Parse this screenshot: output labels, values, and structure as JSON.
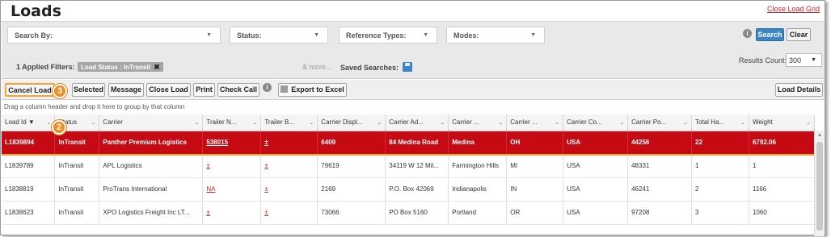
{
  "header": {
    "title": "Loads",
    "close_link": "Close Load Grid"
  },
  "filters": {
    "search_by": "Search By:",
    "status": "Status:",
    "reference_types": "Reference Types:",
    "modes": "Modes:",
    "search_btn": "Search",
    "clear_btn": "Clear",
    "applied_label": "1 Applied Filters:",
    "chip_text": "Load Status : InTransit",
    "chip_close": "✖",
    "more": "& more...",
    "saved_searches": "Saved Searches:",
    "results_count_label": "Results Count:",
    "results_count_value": "300"
  },
  "toolbar": {
    "cancel_load": "Cancel Load",
    "selected": "Selected",
    "message": "Message",
    "close_load": "Close Load",
    "print": "Print",
    "check_call": "Check Call",
    "export_excel": "Export to Excel",
    "load_details": "Load Details",
    "badge_3": "3",
    "badge_2": "2",
    "info": "i"
  },
  "grid": {
    "group_hint": "Drag a column header and drop it here to group by that column",
    "columns": [
      "Load Id ▼",
      "Status",
      "Carrier",
      "Trailer N...",
      "Trailer B...",
      "Carrier Displ...",
      "Carrier Ad...",
      "Carrier ...",
      "Carrier ...",
      "Carrier Co...",
      "Carrier Po...",
      "Total Ha...",
      "Weight"
    ],
    "rows": [
      [
        "L1839894",
        "InTransit",
        "Panther Premium Logistics",
        "538015",
        "±",
        "6409",
        "84 Medina Road",
        "Medina",
        "OH",
        "USA",
        "44256",
        "22",
        "6792.06"
      ],
      [
        "L1839789",
        "InTransit",
        "APL Logistics",
        "±",
        "±",
        "79619",
        "34119 W 12 Mil...",
        "Farmington Hills",
        "MI",
        "USA",
        "48331",
        "1",
        "1"
      ],
      [
        "L1838819",
        "InTransit",
        "ProTrans International",
        "NA",
        "±",
        "2169",
        "P.O. Box 42069",
        "Indianapolis",
        "IN",
        "USA",
        "46241",
        "2",
        "1166"
      ],
      [
        "L1838623",
        "InTransit",
        "XPO Logistics Freight Inc LT...",
        "±",
        "±",
        "73066",
        "PO Box 5160",
        "Portland",
        "OR",
        "USA",
        "97208",
        "3",
        "1060"
      ]
    ]
  },
  "colors": {
    "selected_row": "#c50a14",
    "highlight": "#f0a43a",
    "accent": "#3d86c6"
  }
}
